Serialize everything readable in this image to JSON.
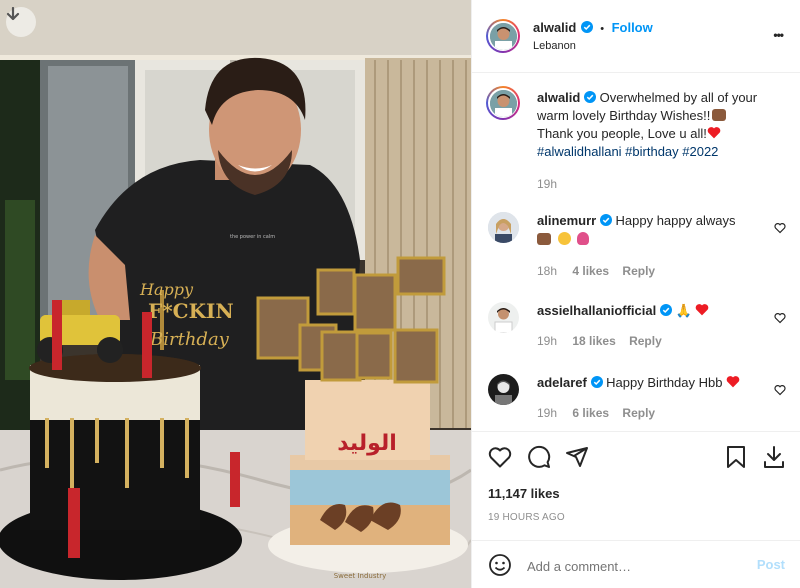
{
  "post": {
    "username": "alwalid",
    "location": "Lebanon",
    "follow_label": "Follow",
    "dot": "•",
    "more_label": "•••",
    "caption": {
      "line1": "Overwhelmed by all of your",
      "line2": "warm lovely Birthday Wishes!!",
      "line3": "Thank you people, Love u all!",
      "hashtags": "#alwalidhallani #birthday #2022",
      "time": "19h"
    },
    "likes": "11,147 likes",
    "posted": "19 HOURS AGO"
  },
  "comments": [
    {
      "username": "alinemurr",
      "text": "Happy happy always",
      "time": "18h",
      "likes": "4 likes",
      "reply": "Reply"
    },
    {
      "username": "assielhallaniofficial",
      "text": "🙏",
      "time": "19h",
      "likes": "18 likes",
      "reply": "Reply"
    },
    {
      "username": "adelaref",
      "text": "Happy Birthday Hbb",
      "time": "19h",
      "likes": "6 likes",
      "reply": "Reply"
    }
  ],
  "composer": {
    "placeholder": "Add a comment…",
    "post_label": "Post"
  },
  "photo": {
    "cake_topper": "Happy F*CKIN Birthday",
    "cake_topper_l1": "Happy",
    "cake_topper_l2": "F*CKIN",
    "cake_topper_l3": "Birthday",
    "cake_logo": "الوليد",
    "board_text": "Sweet Industry",
    "shirt_text": "the power in calm"
  },
  "icons": {
    "download": "download-arrow-icon",
    "verified": "verified-badge-icon",
    "heart": "heart-icon",
    "comment": "comment-icon",
    "share": "share-icon",
    "save": "bookmark-icon",
    "emoji": "emoji-icon"
  },
  "colors": {
    "accent": "#0095f6",
    "heart_red": "#ed4956",
    "hashtag": "#00376b"
  }
}
